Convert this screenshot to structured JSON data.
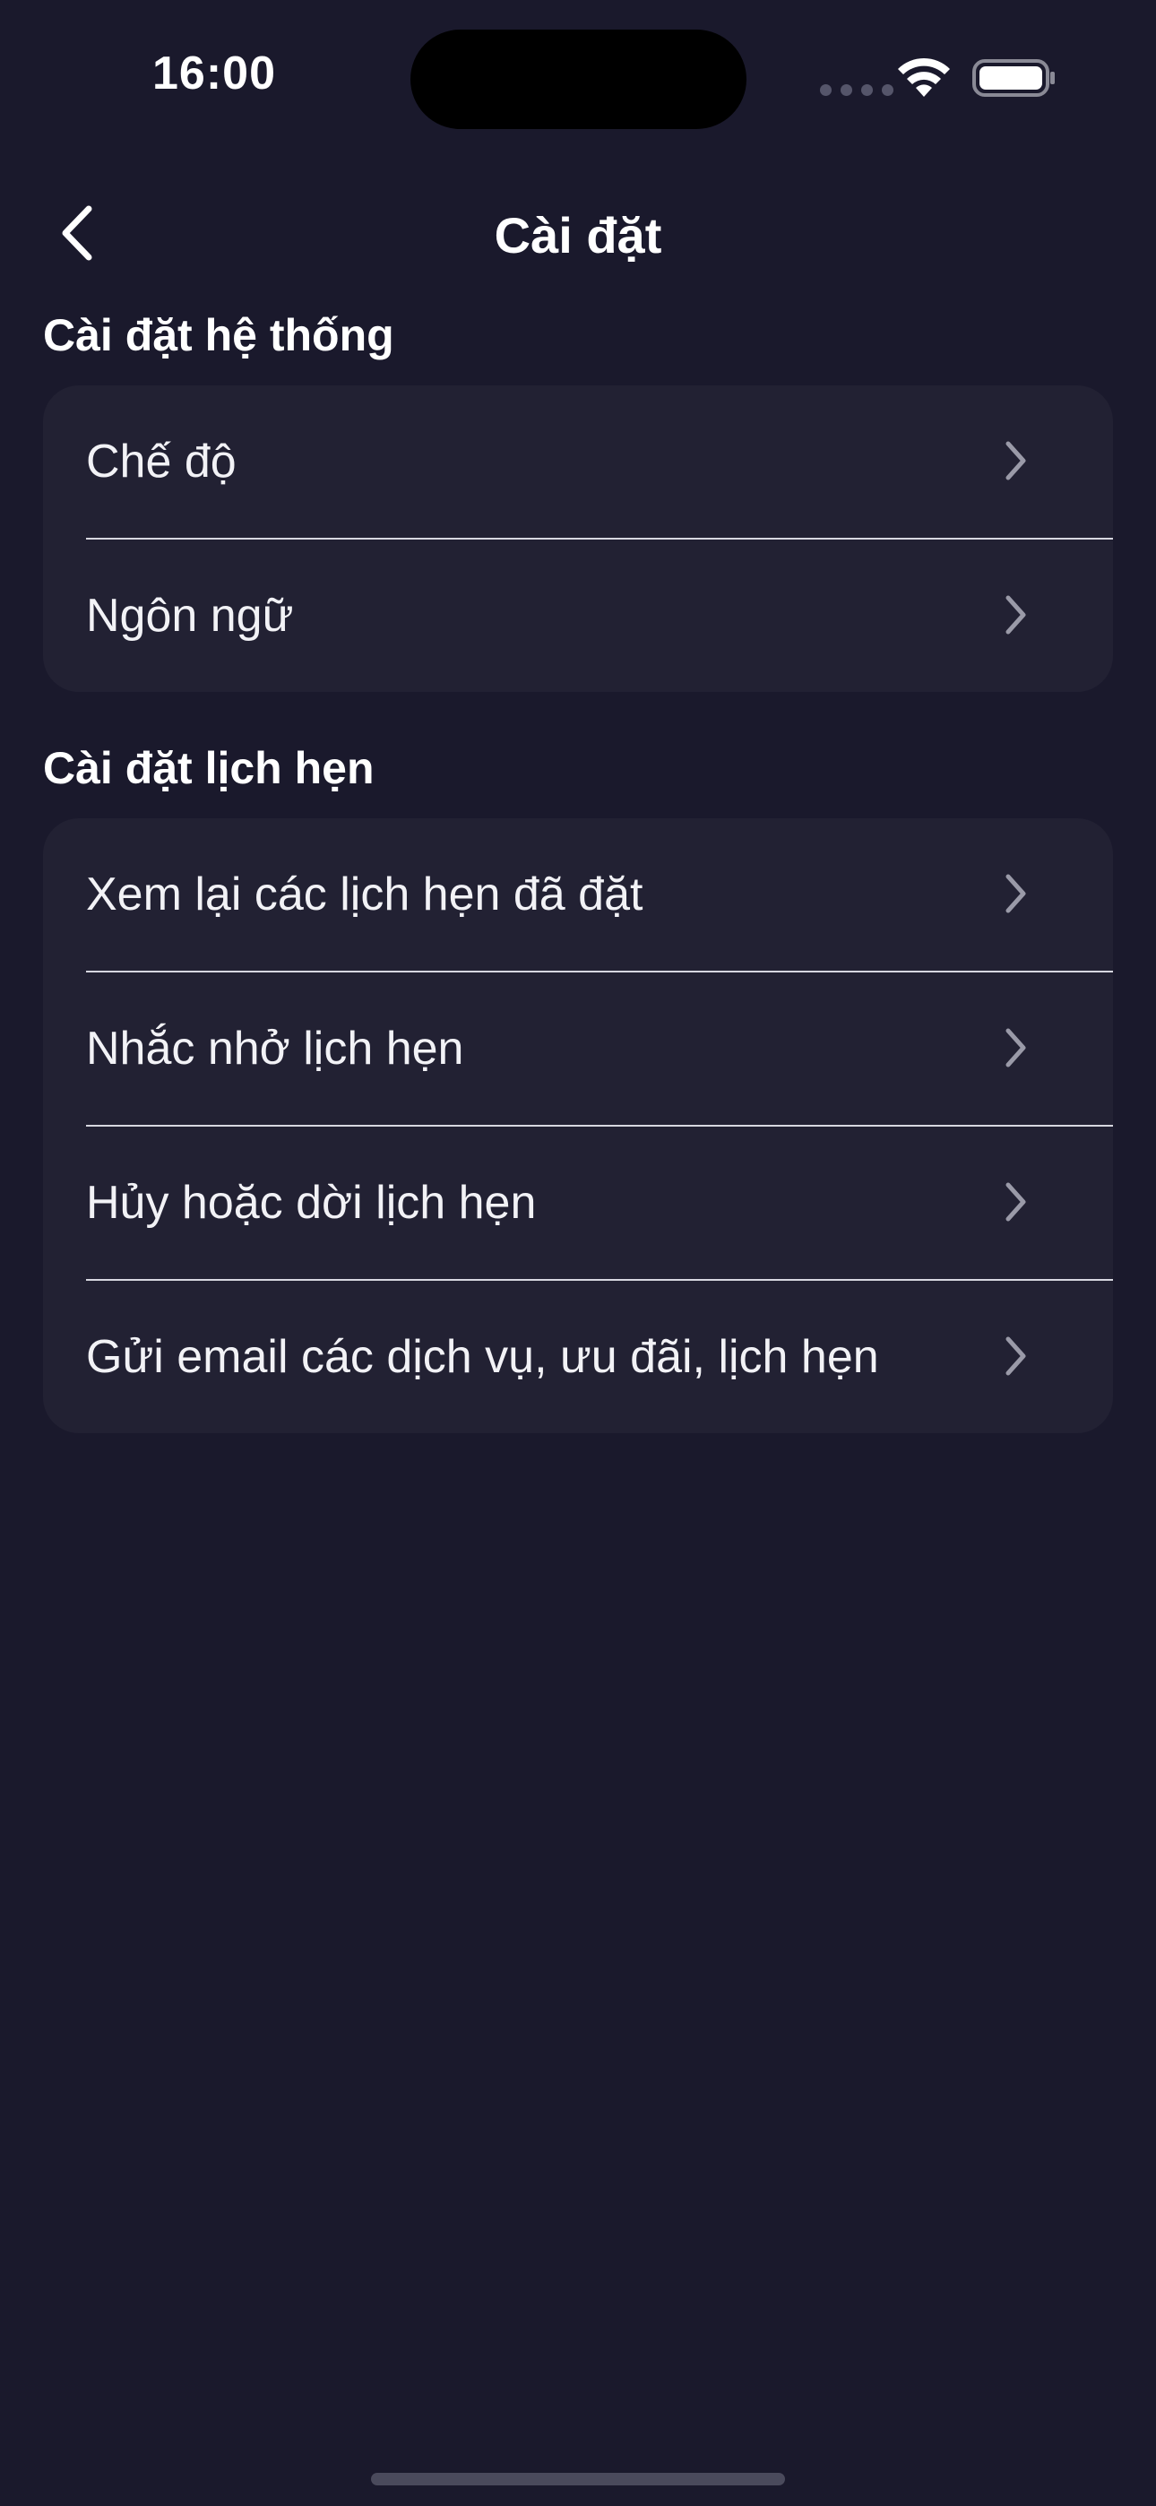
{
  "status_bar": {
    "time": "16:00"
  },
  "nav": {
    "title": "Cài đặt",
    "back_icon": "chevron-left-icon"
  },
  "sections": [
    {
      "header": "Cài đặt hệ thống",
      "items": [
        {
          "label": "Chế độ"
        },
        {
          "label": "Ngôn ngữ"
        }
      ]
    },
    {
      "header": "Cài đặt lịch hẹn",
      "items": [
        {
          "label": "Xem lại các lịch hẹn đã đặt"
        },
        {
          "label": "Nhắc nhở lịch hẹn"
        },
        {
          "label": "Hủy hoặc dời lịch hẹn"
        },
        {
          "label": "Gửi email các dịch vụ, ưu đãi, lịch hẹn"
        }
      ]
    }
  ],
  "colors": {
    "background": "#1a192c",
    "card": "#222133",
    "text": "#ffffff",
    "chevron": "#9a9aa8",
    "divider": "#d7d7e0"
  }
}
